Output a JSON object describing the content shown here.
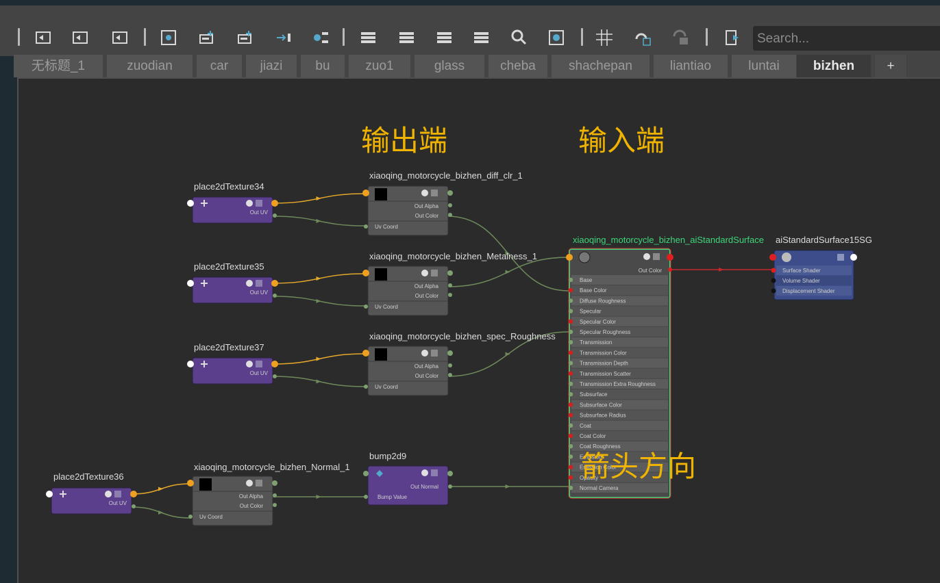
{
  "toolbar": {
    "buttons": [
      "graph-input-icon",
      "graph-input-output-icon",
      "graph-output-icon",
      "frame-selection-icon",
      "add-to-graph-icon",
      "remove-from-graph-icon",
      "rearrange-icon",
      "attribute-filter-icon",
      "simple-view-icon",
      "connected-view-icon",
      "full-view-icon",
      "custom-view-icon",
      "search-icon",
      "dependency-icon",
      "grid-icon",
      "snap-icon",
      "bookmark-icon",
      "export-icon"
    ],
    "search_placeholder": "Search..."
  },
  "tabs": [
    {
      "label": "无标题_1",
      "active": false
    },
    {
      "label": "zuodian",
      "active": false
    },
    {
      "label": "car",
      "active": false
    },
    {
      "label": "jiazi",
      "active": false
    },
    {
      "label": "bu",
      "active": false
    },
    {
      "label": "zuo1",
      "active": false
    },
    {
      "label": "glass",
      "active": false
    },
    {
      "label": "cheba",
      "active": false
    },
    {
      "label": "shachepan",
      "active": false
    },
    {
      "label": "liantiao",
      "active": false
    },
    {
      "label": "luntai",
      "active": false
    },
    {
      "label": "bizhen",
      "active": true
    },
    {
      "label": "+",
      "active": false
    }
  ],
  "annotations": {
    "output_end": "输出端",
    "input_end": "输入端",
    "arrow_direction": "箭头方向"
  },
  "nodes": {
    "place34": {
      "title": "place2dTexture34",
      "port": "Out UV"
    },
    "place35": {
      "title": "place2dTexture35",
      "port": "Out UV"
    },
    "place37": {
      "title": "place2dTexture37",
      "port": "Out UV"
    },
    "place36": {
      "title": "place2dTexture36",
      "port": "Out UV"
    },
    "diff": {
      "title": "xiaoqing_motorcycle_bizhen_diff_clr_1",
      "ports": [
        "Out Alpha",
        "Out Color",
        "Uv Coord"
      ]
    },
    "metal": {
      "title": "xiaoqing_motorcycle_bizhen_Metalness_1",
      "ports": [
        "Out Alpha",
        "Out Color",
        "Uv Coord"
      ]
    },
    "spec": {
      "title": "xiaoqing_motorcycle_bizhen_spec_Roughness",
      "ports": [
        "Out Alpha",
        "Out Color",
        "Uv Coord"
      ]
    },
    "normal": {
      "title": "xiaoqing_motorcycle_bizhen_Normal_1",
      "ports": [
        "Out Alpha",
        "Out Color",
        "Uv Coord"
      ]
    },
    "bump": {
      "title": "bump2d9",
      "ports": [
        "Out Normal",
        "Bump Value"
      ]
    },
    "ai": {
      "title": "xiaoqing_motorcycle_bizhen_aiStandardSurface",
      "out": "Out Color",
      "inputs": [
        "Base",
        "Base Color",
        "Diffuse Roughness",
        "Specular",
        "Specular Color",
        "Specular Roughness",
        "Transmission",
        "Transmission Color",
        "Transmission Depth",
        "Transmission Scatter",
        "Transmission Extra Roughness",
        "Subsurface",
        "Subsurface Color",
        "Subsurface Radius",
        "Coat",
        "Coat Color",
        "Coat Roughness",
        "Emission",
        "Emission Color",
        "Opacity",
        "Normal Camera"
      ]
    },
    "sg": {
      "title": "aiStandardSurface15SG",
      "inputs": [
        "Surface Shader",
        "Volume Shader",
        "Displacement Shader"
      ]
    }
  },
  "colors": {
    "util_node": "#5b3f8c",
    "file_node": "#555555",
    "shader_node": "#4a4a4a",
    "sg_node": "#3d4d8c",
    "link_green": "#6f8a5a",
    "link_orange": "#e7a92a",
    "link_red": "#c8282a",
    "annotation": "#f0b400",
    "selected_border": "#3fd67a"
  }
}
